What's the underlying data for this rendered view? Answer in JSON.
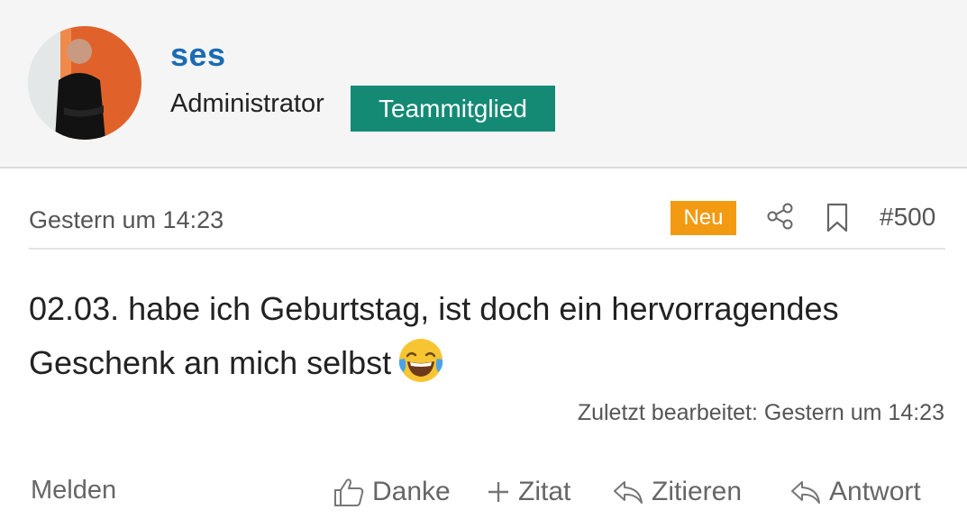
{
  "user": {
    "name": "ses",
    "role": "Administrator",
    "badge": "Teammitglied",
    "badge_color": "#148a75",
    "name_color": "#1b6bb3"
  },
  "post": {
    "date": "Gestern um 14:23",
    "new_badge": "Neu",
    "new_badge_color": "#f39a13",
    "number": "#500",
    "text": "02.03. habe ich Geburtstag, ist doch ein hervorragendes Geschenk an mich selbst",
    "emoji": "face-with-tears-of-joy",
    "edited": "Zuletzt bearbeitet: Gestern um 14:23"
  },
  "icons": {
    "share": "share-icon",
    "bookmark": "bookmark-icon"
  },
  "actions": {
    "report": "Melden",
    "thanks": "Danke",
    "quote": "Zitat",
    "cite": "Zitieren",
    "reply": "Antwort"
  }
}
